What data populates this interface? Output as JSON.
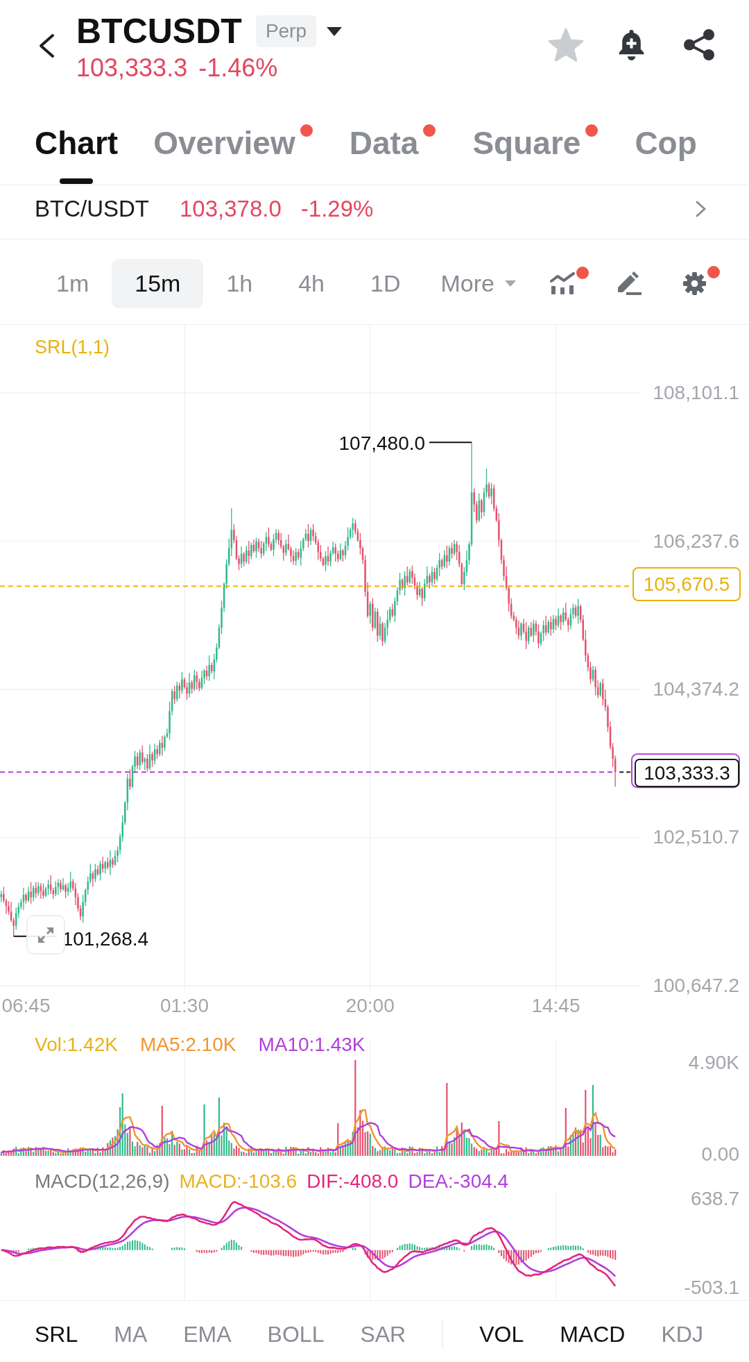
{
  "header": {
    "symbol": "BTCUSDT",
    "badge": "Perp",
    "price": "103,333.3",
    "change": "-1.46%",
    "favorite": false
  },
  "tabs": [
    {
      "label": "Chart",
      "selected": true,
      "dot": false
    },
    {
      "label": "Overview",
      "selected": false,
      "dot": true
    },
    {
      "label": "Data",
      "selected": false,
      "dot": true
    },
    {
      "label": "Square",
      "selected": false,
      "dot": true
    },
    {
      "label": "Cop",
      "selected": false,
      "dot": false
    }
  ],
  "spot_ticker": {
    "pair": "BTC/USDT",
    "price": "103,378.0",
    "change": "-1.29%"
  },
  "intervals": [
    {
      "label": "1m",
      "selected": false
    },
    {
      "label": "15m",
      "selected": true
    },
    {
      "label": "1h",
      "selected": false
    },
    {
      "label": "4h",
      "selected": false
    },
    {
      "label": "1D",
      "selected": false
    }
  ],
  "more_menu": {
    "label": "More"
  },
  "tools": [
    {
      "kind": "indicators",
      "dot": true
    },
    {
      "kind": "draw",
      "dot": false
    },
    {
      "kind": "settings",
      "dot": true
    }
  ],
  "main_chart": {
    "indicator_label": "SRL(1,1)",
    "chart_data": {
      "type": "candlestick",
      "grid": true,
      "ylim": [
        100647.2,
        108101.1
      ],
      "yticks": [
        {
          "value": 108101.1,
          "label": "108,101.1"
        },
        {
          "value": 106237.6,
          "label": "106,237.6"
        },
        {
          "value": 104374.2,
          "label": "104,374.2"
        },
        {
          "value": 102510.7,
          "label": "102,510.7"
        },
        {
          "value": 100647.2,
          "label": "100,647.2"
        }
      ],
      "ref_lines": [
        {
          "axis": "y",
          "value": 105670.5,
          "label": "105,670.5",
          "color": "#e9b10e"
        },
        {
          "axis": "y",
          "value": 103333.3,
          "label": "103,333.3",
          "color": "#b43fdc"
        }
      ],
      "annotations": [
        "107,480.0",
        "101,268.4"
      ],
      "categories": [
        null,
        null,
        null,
        null,
        null,
        null,
        null,
        null,
        null,
        null,
        "06:45",
        null,
        null,
        null,
        null,
        null,
        null,
        null,
        null,
        null,
        null,
        null,
        null,
        null,
        null,
        null,
        null,
        null,
        null,
        null,
        null,
        null,
        null,
        null,
        null,
        null,
        null,
        null,
        null,
        null,
        null,
        null,
        null,
        null,
        null,
        null,
        null,
        null,
        null,
        null,
        null,
        null,
        null,
        null,
        null,
        null,
        null,
        null,
        null,
        null,
        null,
        null,
        null,
        null,
        null,
        null,
        null,
        null,
        null,
        null,
        null,
        null,
        null,
        null,
        "01:30",
        null,
        null,
        null,
        null,
        null,
        null,
        null,
        null,
        null,
        null,
        null,
        null,
        null,
        null,
        null,
        null,
        null,
        null,
        null,
        null,
        null,
        null,
        null,
        null,
        null,
        null,
        null,
        null,
        null,
        null,
        null,
        null,
        null,
        null,
        null,
        null,
        null,
        null,
        null,
        null,
        null,
        null,
        null,
        null,
        null,
        null,
        null,
        null,
        null,
        null,
        null,
        null,
        null,
        null,
        null,
        null,
        null,
        null,
        null,
        null,
        null,
        null,
        null,
        null,
        null,
        null,
        null,
        null,
        null,
        null,
        null,
        null,
        null,
        null,
        "20:00",
        null,
        null,
        null,
        null,
        null,
        null,
        null,
        null,
        null,
        null,
        null,
        null,
        null,
        null,
        null,
        null,
        null,
        null,
        null,
        null,
        null,
        null,
        null,
        null,
        null,
        null,
        null,
        null,
        null,
        null,
        null,
        null,
        null,
        null,
        null,
        null,
        null,
        null,
        null,
        null,
        null,
        null,
        null,
        null,
        null,
        null,
        null,
        null,
        null,
        null,
        null,
        null,
        null,
        null,
        null,
        null,
        null,
        null,
        null,
        null,
        null,
        null,
        null,
        null,
        null,
        null,
        null,
        null,
        null,
        null,
        null,
        null,
        null,
        null,
        "14:45",
        null,
        null,
        null,
        null,
        null,
        null,
        null,
        null,
        null,
        null,
        null,
        null,
        null,
        null,
        null,
        null,
        null,
        null,
        null,
        null,
        null,
        null,
        null,
        null
      ],
      "ohlc": [
        [
          101760,
          101840,
          101700,
          101800
        ],
        [
          101800,
          101890,
          101690,
          101720
        ],
        [
          101720,
          101740,
          101550,
          101650
        ],
        [
          101650,
          101710,
          101540,
          101580
        ],
        [
          101580,
          101700,
          101450,
          101470
        ],
        [
          101470,
          101500,
          101268.4,
          101400
        ],
        [
          101400,
          101630,
          101350,
          101560
        ],
        [
          101560,
          101690,
          101500,
          101640
        ],
        [
          101640,
          101740,
          101610,
          101700
        ],
        [
          101700,
          101880,
          101600,
          101790
        ],
        [
          101790,
          101810,
          101680,
          101720
        ],
        [
          101720,
          101890,
          101700,
          101830
        ],
        [
          101830,
          101950,
          101680,
          101760
        ],
        [
          101760,
          101910,
          101710,
          101880
        ],
        [
          101880,
          101950,
          101750,
          101810
        ],
        [
          101810,
          101950,
          101780,
          101900
        ],
        [
          101900,
          101940,
          101740,
          101840
        ],
        [
          101840,
          101930,
          101740,
          101780
        ],
        [
          101780,
          101890,
          101760,
          101870
        ],
        [
          101870,
          101980,
          101790,
          101920
        ],
        [
          101920,
          102040,
          101800,
          101850
        ],
        [
          101850,
          101880,
          101740,
          101800
        ],
        [
          101800,
          101960,
          101770,
          101890
        ],
        [
          101890,
          101990,
          101790,
          101940
        ],
        [
          101940,
          101980,
          101820,
          101860
        ],
        [
          101860,
          102000,
          101840,
          101910
        ],
        [
          101910,
          101930,
          101750,
          101830
        ],
        [
          101830,
          101940,
          101780,
          101880
        ],
        [
          101880,
          102080,
          101820,
          101960
        ],
        [
          101960,
          101990,
          101840,
          101870
        ],
        [
          101870,
          101940,
          101660,
          101760
        ],
        [
          101760,
          101810,
          101580,
          101620
        ],
        [
          101620,
          101660,
          101470,
          101520
        ],
        [
          101520,
          101790,
          101440,
          101700
        ],
        [
          101700,
          101870,
          101650,
          101850
        ],
        [
          101850,
          102020,
          101790,
          101960
        ],
        [
          101960,
          102180,
          101930,
          102060
        ],
        [
          102060,
          102090,
          101890,
          101990
        ],
        [
          101990,
          102180,
          101950,
          102110
        ],
        [
          102110,
          102160,
          102030,
          102050
        ],
        [
          102050,
          102220,
          101970,
          102180
        ],
        [
          102180,
          102270,
          102070,
          102120
        ],
        [
          102120,
          102220,
          102060,
          102200
        ],
        [
          102200,
          102260,
          102110,
          102140
        ],
        [
          102140,
          102350,
          102040,
          102230
        ],
        [
          102230,
          102260,
          102130,
          102170
        ],
        [
          102170,
          102350,
          102150,
          102280
        ],
        [
          102280,
          102400,
          102200,
          102350
        ],
        [
          102350,
          102560,
          102300,
          102520
        ],
        [
          102520,
          102790,
          102460,
          102700
        ],
        [
          102700,
          102970,
          102670,
          102950
        ],
        [
          102950,
          103310,
          102850,
          103250
        ],
        [
          103250,
          103370,
          103110,
          103150
        ],
        [
          103150,
          103430,
          103130,
          103400
        ],
        [
          103400,
          103600,
          103320,
          103530
        ],
        [
          103530,
          103580,
          103370,
          103420
        ],
        [
          103420,
          103620,
          103360,
          103580
        ],
        [
          103580,
          103670,
          103430,
          103460
        ],
        [
          103460,
          103520,
          103360,
          103500
        ],
        [
          103500,
          103560,
          103340,
          103380
        ],
        [
          103380,
          103680,
          103360,
          103560
        ],
        [
          103560,
          103590,
          103400,
          103480
        ],
        [
          103480,
          103690,
          103430,
          103620
        ],
        [
          103620,
          103670,
          103500,
          103560
        ],
        [
          103560,
          103740,
          103530,
          103700
        ],
        [
          103700,
          103790,
          103540,
          103640
        ],
        [
          103640,
          103800,
          103600,
          103780
        ],
        [
          103780,
          103880,
          103760,
          103820
        ],
        [
          103820,
          104220,
          103740,
          104100
        ],
        [
          104100,
          104380,
          104050,
          104350
        ],
        [
          104350,
          104420,
          104190,
          104250
        ],
        [
          104250,
          104470,
          104220,
          104420
        ],
        [
          104420,
          104460,
          104260,
          104360
        ],
        [
          104360,
          104590,
          104320,
          104500
        ],
        [
          104500,
          104520,
          104380,
          104400
        ],
        [
          104400,
          104460,
          104240,
          104320
        ],
        [
          104320,
          104580,
          104270,
          104460
        ],
        [
          104460,
          104490,
          104320,
          104380
        ],
        [
          104380,
          104620,
          104350,
          104550
        ],
        [
          104550,
          104600,
          104370,
          104470
        ],
        [
          104470,
          104510,
          104350,
          104390
        ],
        [
          104390,
          104610,
          104370,
          104520
        ],
        [
          104520,
          104630,
          104440,
          104610
        ],
        [
          104610,
          104670,
          104490,
          104540
        ],
        [
          104540,
          104800,
          104480,
          104680
        ],
        [
          104680,
          104710,
          104570,
          104600
        ],
        [
          104600,
          104820,
          104500,
          104750
        ],
        [
          104750,
          104950,
          104710,
          104900
        ],
        [
          104900,
          105190,
          104880,
          105150
        ],
        [
          105150,
          105490,
          105070,
          105400
        ],
        [
          105400,
          105720,
          105350,
          105700
        ],
        [
          105700,
          106010,
          105640,
          105950
        ],
        [
          105950,
          106270,
          105920,
          106150
        ],
        [
          106150,
          106650,
          106050,
          106380
        ],
        [
          106380,
          106450,
          106210,
          106250
        ],
        [
          106250,
          106300,
          106000,
          106020
        ],
        [
          106020,
          106060,
          105870,
          105950
        ],
        [
          105950,
          106170,
          105900,
          106080
        ],
        [
          106080,
          106100,
          105920,
          105980
        ],
        [
          105980,
          106180,
          105950,
          106120
        ],
        [
          106120,
          106240,
          105950,
          106050
        ],
        [
          106050,
          106220,
          106010,
          106190
        ],
        [
          106190,
          106260,
          106090,
          106110
        ],
        [
          106110,
          106280,
          106030,
          106230
        ],
        [
          106230,
          106270,
          106100,
          106150
        ],
        [
          106150,
          106240,
          106020,
          106080
        ],
        [
          106080,
          106230,
          106050,
          106210
        ],
        [
          106210,
          106350,
          106110,
          106290
        ],
        [
          106290,
          106410,
          106160,
          106200
        ],
        [
          106200,
          106230,
          106110,
          106130
        ],
        [
          106130,
          106330,
          106050,
          106260
        ],
        [
          106260,
          106390,
          106210,
          106340
        ],
        [
          106340,
          106380,
          106190,
          106250
        ],
        [
          106250,
          106340,
          106140,
          106170
        ],
        [
          106170,
          106190,
          105990,
          106090
        ],
        [
          106090,
          106260,
          106050,
          106200
        ],
        [
          106200,
          106320,
          106120,
          106140
        ],
        [
          106140,
          106170,
          105970,
          106050
        ],
        [
          106050,
          106120,
          105940,
          105990
        ],
        [
          105990,
          106150,
          105930,
          106100
        ],
        [
          106100,
          106140,
          106000,
          106030
        ],
        [
          106030,
          106240,
          105930,
          106150
        ],
        [
          106150,
          106280,
          106110,
          106260
        ],
        [
          106260,
          106390,
          106240,
          106330
        ],
        [
          106330,
          106450,
          106160,
          106240
        ],
        [
          106240,
          106410,
          106190,
          106380
        ],
        [
          106380,
          106450,
          106240,
          106300
        ],
        [
          106300,
          106350,
          106190,
          106220
        ],
        [
          106220,
          106260,
          106000,
          106100
        ],
        [
          106100,
          106190,
          105980,
          106020
        ],
        [
          106020,
          106040,
          105920,
          105940
        ],
        [
          105940,
          106110,
          105860,
          106050
        ],
        [
          106050,
          106170,
          105930,
          105980
        ],
        [
          105980,
          106120,
          105920,
          106090
        ],
        [
          106090,
          106230,
          106060,
          106160
        ],
        [
          106160,
          106210,
          105980,
          106080
        ],
        [
          106080,
          106120,
          105970,
          106010
        ],
        [
          106010,
          106210,
          105990,
          106120
        ],
        [
          106120,
          106140,
          105980,
          106060
        ],
        [
          106060,
          106240,
          106010,
          106180
        ],
        [
          106180,
          106410,
          106120,
          106290
        ],
        [
          106290,
          106410,
          106260,
          106380
        ],
        [
          106380,
          106530,
          106280,
          106460
        ],
        [
          106460,
          106510,
          106320,
          106360
        ],
        [
          106360,
          106400,
          106230,
          106250
        ],
        [
          106250,
          106340,
          106070,
          106150
        ],
        [
          106150,
          106170,
          105950,
          106000
        ],
        [
          106000,
          106060,
          105540,
          105600
        ],
        [
          105600,
          105720,
          105270,
          105300
        ],
        [
          105300,
          105480,
          105200,
          105450
        ],
        [
          105450,
          105520,
          105110,
          105150
        ],
        [
          105150,
          105400,
          105130,
          105350
        ],
        [
          105350,
          105390,
          104970,
          105050
        ],
        [
          105050,
          105290,
          105000,
          105200
        ],
        [
          105200,
          105220,
          104920,
          104980
        ],
        [
          104980,
          105210,
          104950,
          105150
        ],
        [
          105150,
          105370,
          105050,
          105250
        ],
        [
          105250,
          105410,
          105210,
          105380
        ],
        [
          105380,
          105450,
          105280,
          105300
        ],
        [
          105300,
          105530,
          105220,
          105480
        ],
        [
          105480,
          105660,
          105430,
          105620
        ],
        [
          105620,
          105840,
          105560,
          105750
        ],
        [
          105750,
          105770,
          105620,
          105650
        ],
        [
          105650,
          105860,
          105550,
          105800
        ],
        [
          105800,
          105920,
          105680,
          105720
        ],
        [
          105720,
          105890,
          105700,
          105860
        ],
        [
          105860,
          105930,
          105700,
          105780
        ],
        [
          105780,
          105830,
          105630,
          105680
        ],
        [
          105680,
          105720,
          105500,
          105560
        ],
        [
          105560,
          105730,
          105530,
          105640
        ],
        [
          105640,
          105660,
          105420,
          105520
        ],
        [
          105520,
          105760,
          105480,
          105700
        ],
        [
          105700,
          105920,
          105680,
          105800
        ],
        [
          105800,
          105830,
          105640,
          105720
        ],
        [
          105720,
          105920,
          105670,
          105850
        ],
        [
          105850,
          105900,
          105700,
          105760
        ],
        [
          105760,
          105940,
          105730,
          105900
        ],
        [
          105900,
          106090,
          105800,
          106000
        ],
        [
          106000,
          106020,
          105880,
          105920
        ],
        [
          105920,
          106120,
          105900,
          106060
        ],
        [
          106060,
          106180,
          105900,
          105980
        ],
        [
          105980,
          106180,
          105930,
          106150
        ],
        [
          106150,
          106220,
          106020,
          106080
        ],
        [
          106080,
          106250,
          106050,
          106200
        ],
        [
          106200,
          106240,
          106000,
          106100
        ],
        [
          106100,
          106190,
          105910,
          105950
        ],
        [
          105950,
          105970,
          105680,
          105700
        ],
        [
          105700,
          105910,
          105620,
          105850
        ],
        [
          105850,
          106120,
          105800,
          106000
        ],
        [
          106000,
          106230,
          105940,
          106200
        ],
        [
          106200,
          107480,
          106170,
          106850
        ],
        [
          106850,
          106900,
          106600,
          106700
        ],
        [
          106700,
          106740,
          106460,
          106500
        ],
        [
          106500,
          106840,
          106480,
          106750
        ],
        [
          106750,
          106770,
          106520,
          106600
        ],
        [
          106600,
          106910,
          106550,
          106850
        ],
        [
          106850,
          107150,
          106790,
          106950
        ],
        [
          106950,
          106980,
          106770,
          106800
        ],
        [
          106800,
          106970,
          106700,
          106900
        ],
        [
          106900,
          106950,
          106610,
          106650
        ],
        [
          106650,
          106690,
          106480,
          106500
        ],
        [
          106500,
          106590,
          106170,
          106250
        ],
        [
          106250,
          106270,
          105950,
          106000
        ],
        [
          106000,
          106060,
          105740,
          105800
        ],
        [
          105800,
          105920,
          105620,
          105650
        ],
        [
          105650,
          105680,
          105350,
          105450
        ],
        [
          105450,
          105520,
          105260,
          105300
        ],
        [
          105300,
          105350,
          105230,
          105250
        ],
        [
          105250,
          105290,
          105070,
          105150
        ],
        [
          105150,
          105240,
          105000,
          105050
        ],
        [
          105050,
          105220,
          104990,
          105200
        ],
        [
          105200,
          105260,
          105070,
          105100
        ],
        [
          105100,
          105220,
          104880,
          104980
        ],
        [
          104980,
          105180,
          104940,
          105150
        ],
        [
          105150,
          105220,
          105030,
          105050
        ],
        [
          105050,
          105250,
          104970,
          105200
        ],
        [
          105200,
          105240,
          105050,
          105100
        ],
        [
          105100,
          105190,
          104890,
          104950
        ],
        [
          104950,
          105100,
          104920,
          105080
        ],
        [
          105080,
          105240,
          104980,
          105180
        ],
        [
          105180,
          105300,
          105050,
          105090
        ],
        [
          105090,
          105250,
          105070,
          105220
        ],
        [
          105220,
          105290,
          105050,
          105130
        ],
        [
          105130,
          105310,
          105080,
          105260
        ],
        [
          105260,
          105300,
          105120,
          105180
        ],
        [
          105180,
          105390,
          105150,
          105300
        ],
        [
          105300,
          105320,
          105120,
          105220
        ],
        [
          105220,
          105400,
          105180,
          105340
        ],
        [
          105340,
          105460,
          105230,
          105250
        ],
        [
          105250,
          105280,
          105100,
          105180
        ],
        [
          105180,
          105390,
          105130,
          105320
        ],
        [
          105320,
          105450,
          105260,
          105400
        ],
        [
          105400,
          105440,
          105270,
          105300
        ],
        [
          105300,
          105510,
          105200,
          105420
        ],
        [
          105420,
          105440,
          105210,
          105250
        ],
        [
          105250,
          105310,
          104980,
          105000
        ],
        [
          105000,
          105120,
          104720,
          104800
        ],
        [
          104800,
          104830,
          104600,
          104650
        ],
        [
          104650,
          104720,
          104440,
          104500
        ],
        [
          104500,
          104670,
          104470,
          104620
        ],
        [
          104620,
          104660,
          104300,
          104400
        ],
        [
          104400,
          104490,
          104260,
          104300
        ],
        [
          104300,
          104470,
          104280,
          104450
        ],
        [
          104450,
          104510,
          104170,
          104250
        ],
        [
          104250,
          104370,
          104100,
          104150
        ],
        [
          104150,
          104180,
          103840,
          103900
        ],
        [
          103900,
          103970,
          103620,
          103650
        ],
        [
          103650,
          103700,
          103400,
          103500
        ],
        [
          103500,
          103540,
          103150,
          103333.3
        ]
      ]
    }
  },
  "volume": {
    "legend": [
      {
        "text": "Vol:1.42K",
        "color": "#e8b21c"
      },
      {
        "text": "MA5:2.10K",
        "color": "#f0952e"
      },
      {
        "text": "MA10:1.43K",
        "color": "#b23fdc"
      }
    ],
    "axis": [
      "4.90K",
      "0.00"
    ]
  },
  "macd": {
    "legend": [
      {
        "text": "MACD(12,26,9)",
        "color": "#777a80"
      },
      {
        "text": "MACD:-103.6",
        "color": "#e8b21c"
      },
      {
        "text": "DIF:-408.0",
        "color": "#e3277c"
      },
      {
        "text": "DEA:-304.4",
        "color": "#b23fdc"
      }
    ],
    "axis": [
      "638.7",
      "-503.1"
    ]
  },
  "indicator_tabs": {
    "main": [
      {
        "label": "SRL",
        "selected": true
      },
      {
        "label": "MA",
        "selected": false
      },
      {
        "label": "EMA",
        "selected": false
      },
      {
        "label": "BOLL",
        "selected": false
      },
      {
        "label": "SAR",
        "selected": false
      }
    ],
    "sub": [
      {
        "label": "VOL",
        "selected": true
      },
      {
        "label": "MACD",
        "selected": true
      },
      {
        "label": "KDJ",
        "selected": false
      }
    ]
  }
}
